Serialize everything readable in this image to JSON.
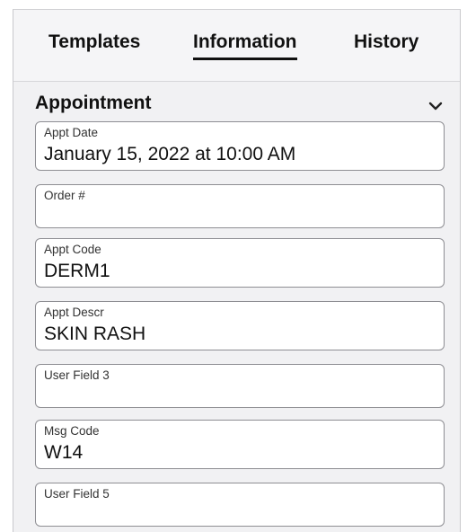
{
  "tabs": [
    {
      "label": "Templates"
    },
    {
      "label": "Information"
    },
    {
      "label": "History"
    }
  ],
  "section": {
    "title": "Appointment"
  },
  "fields": [
    {
      "label": "Appt Date",
      "value": "January 15, 2022 at 10:00 AM"
    },
    {
      "label": "Order #",
      "value": ""
    },
    {
      "label": "Appt Code",
      "value": "DERM1"
    },
    {
      "label": "Appt Descr",
      "value": "SKIN RASH"
    },
    {
      "label": "User Field 3",
      "value": ""
    },
    {
      "label": "Msg Code",
      "value": "W14"
    },
    {
      "label": "User Field 5",
      "value": ""
    }
  ]
}
